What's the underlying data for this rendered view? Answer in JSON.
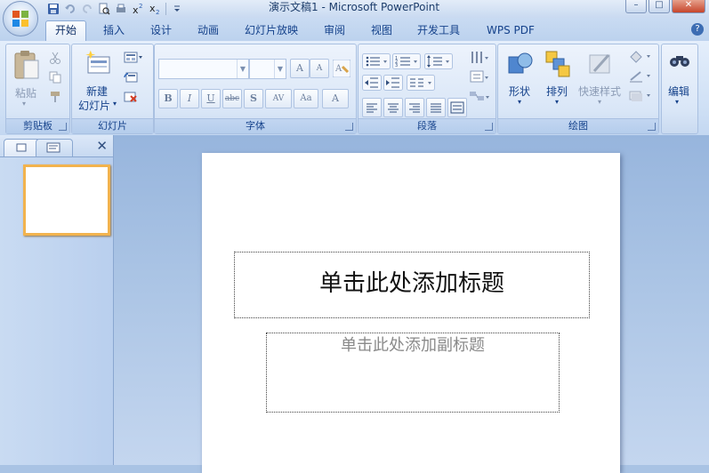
{
  "window": {
    "title": "演示文稿1 - Microsoft PowerPoint"
  },
  "tabs": [
    "开始",
    "插入",
    "设计",
    "动画",
    "幻灯片放映",
    "审阅",
    "视图",
    "开发工具",
    "WPS PDF"
  ],
  "active_tab": "开始",
  "groups": {
    "clipboard": {
      "label": "剪贴板",
      "paste": "粘贴"
    },
    "slides": {
      "label": "幻灯片",
      "new_slide_line1": "新建",
      "new_slide_line2": "幻灯片"
    },
    "font": {
      "label": "字体",
      "bold": "B",
      "italic": "I",
      "underline": "U",
      "strike": "abc",
      "shadow": "S",
      "spacing": "AV",
      "case": "Aa",
      "color": "A",
      "grow": "A",
      "shrink": "A"
    },
    "paragraph": {
      "label": "段落"
    },
    "drawing": {
      "label": "绘图",
      "shapes": "形状",
      "arrange": "排列",
      "quick_styles": "快速样式"
    },
    "editing": {
      "label": "编辑"
    }
  },
  "slide": {
    "title_placeholder": "单击此处添加标题",
    "subtitle_placeholder": "单击此处添加副标题"
  },
  "colors": {
    "accent": "#15428b",
    "thumb_border": "#f2b34e"
  }
}
